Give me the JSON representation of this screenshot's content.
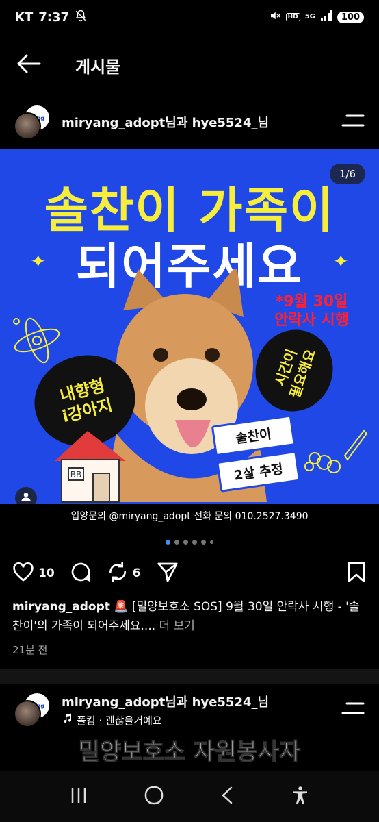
{
  "status_bar": {
    "carrier": "KT",
    "time": "7:37",
    "hd": "HD",
    "network": "5G",
    "battery": "100"
  },
  "header": {
    "title": "게시물"
  },
  "post1": {
    "header_text": "miryang_adopt님과 hye5524_님",
    "avatar_small_text": "yang",
    "image": {
      "counter": "1/6",
      "headline_line1": "솔찬이 가족이",
      "headline_line2": "되어주세요",
      "red_note_line1": "*9월 30일",
      "red_note_line2": "안락사 시행",
      "bubble_left_line1": "내향형",
      "bubble_left_line2": "i강아지",
      "bubble_right_line1": "시간이",
      "bubble_right_line2": "필요해요",
      "name_card_line1": "솔찬이",
      "name_card_line2": "2살 추정",
      "house_window": "BB",
      "footer": "입양문의 @miryang_adopt  전화 문의 010.2527.3490"
    },
    "carousel": {
      "count": 6,
      "active": 0
    },
    "likes": "10",
    "reposts": "6",
    "caption_user": "miryang_adopt",
    "caption_text": " 🚨 [밀양보호소 SOS] 9월 30일 안락사 시행 - '솔찬이'의 가족이 되어주세요.... ",
    "caption_more": "더 보기",
    "time": "21분 전"
  },
  "post2": {
    "header_text": "miryang_adopt님과 hye5524_님",
    "music": "폴킴 · 괜찮을거예요",
    "video_text": "밀양보호소 자원봉사자"
  },
  "icons": {
    "back": "arrow-left-icon",
    "menu": "menu-lines-icon",
    "like": "heart-icon",
    "comment": "comment-icon",
    "repost": "repost-icon",
    "share": "send-icon",
    "save": "bookmark-icon",
    "user_tag": "user-icon",
    "music": "music-note-icon"
  },
  "colors": {
    "background": "#000000",
    "poster_blue": "#1f48e6",
    "poster_yellow": "#f7ee3c",
    "alert_red": "#ff2030",
    "active_dot": "#4a8af4"
  }
}
